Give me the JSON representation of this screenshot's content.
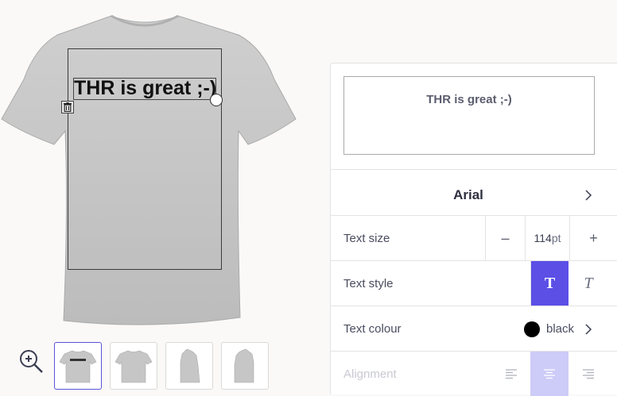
{
  "product": {
    "design_text": "THR is great ;-)",
    "thumbnails": [
      "front-with-design",
      "front",
      "back",
      "side"
    ],
    "active_thumbnail": 0
  },
  "editor": {
    "text_value": "THR is great ;-)",
    "font": "Arial",
    "text_size": {
      "label": "Text size",
      "value": "114",
      "unit": "pt",
      "decrement": "–",
      "increment": "+"
    },
    "text_style": {
      "label": "Text style",
      "bold_glyph": "T",
      "italic_glyph": "T",
      "active": "bold"
    },
    "text_colour": {
      "label": "Text colour",
      "value": "black",
      "swatch": "#000000"
    },
    "alignment": {
      "label": "Alignment",
      "options": [
        "left",
        "center",
        "right"
      ],
      "active": "center"
    }
  },
  "colors": {
    "accent": "#5b4fe6",
    "accent_light": "#cdcbf7",
    "shirt": "#c8c8c8"
  }
}
